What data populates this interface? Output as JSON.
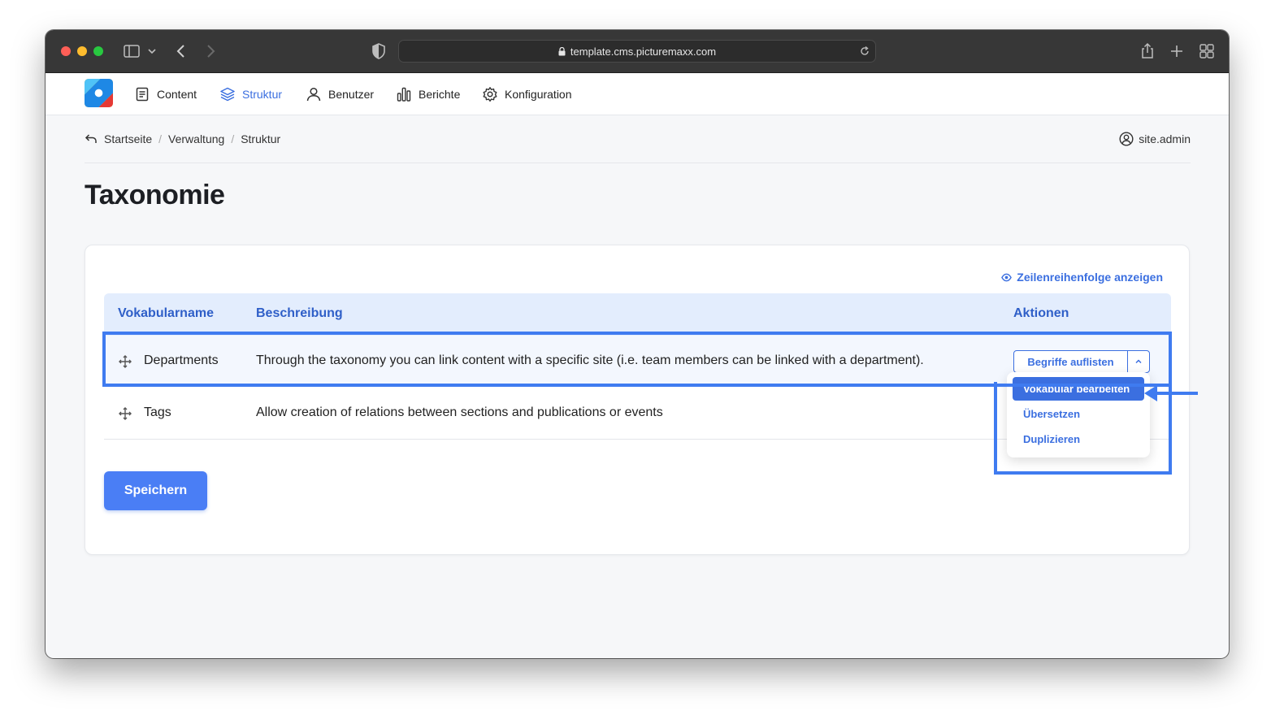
{
  "browser": {
    "url": "template.cms.picturemaxx.com"
  },
  "nav": {
    "items": [
      {
        "label": "Content",
        "icon": "document-icon"
      },
      {
        "label": "Struktur",
        "icon": "layers-icon",
        "active": true
      },
      {
        "label": "Benutzer",
        "icon": "user-icon"
      },
      {
        "label": "Berichte",
        "icon": "bar-chart-icon"
      },
      {
        "label": "Konfiguration",
        "icon": "gear-icon"
      }
    ]
  },
  "breadcrumb": [
    "Startseite",
    "Verwaltung",
    "Struktur"
  ],
  "user": {
    "name": "site.admin"
  },
  "page": {
    "title": "Taxonomie"
  },
  "table": {
    "order_link": "Zeilenreihenfolge anzeigen",
    "headers": [
      "Vokabularname",
      "Beschreibung",
      "Aktionen"
    ],
    "rows": [
      {
        "name": "Departments",
        "description": "Through the taxonomy you can link content with a specific site (i.e. team members can be linked with a department)."
      },
      {
        "name": "Tags",
        "description": "Allow creation of relations between sections and publications or events"
      }
    ],
    "action_button": "Begriffe auflisten",
    "dropdown": [
      "Vokabular bearbeiten",
      "Übersetzen",
      "Duplizieren"
    ]
  },
  "save_button": "Speichern",
  "colors": {
    "accent": "#3b6fe0",
    "header_bg": "#e3edfd",
    "highlight": "#3f7bf0",
    "save": "#4a7ef5"
  }
}
